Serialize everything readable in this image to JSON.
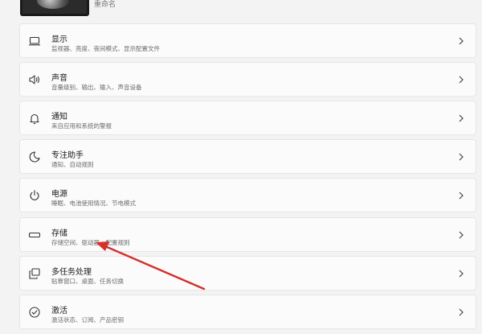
{
  "header": {
    "account_label": "重命名"
  },
  "settings": [
    {
      "icon": "monitor-icon",
      "title": "显示",
      "subtitle": "监视器、亮度、夜间模式、显示配置文件"
    },
    {
      "icon": "speaker-icon",
      "title": "声音",
      "subtitle": "音量级别、输出、输入、声音设备"
    },
    {
      "icon": "bell-icon",
      "title": "通知",
      "subtitle": "来自应用和系统的警报"
    },
    {
      "icon": "moon-icon",
      "title": "专注助手",
      "subtitle": "通知、自动规则"
    },
    {
      "icon": "power-icon",
      "title": "电源",
      "subtitle": "睡眠、电池使用情况、节电模式"
    },
    {
      "icon": "storage-icon",
      "title": "存储",
      "subtitle": "存储空间、驱动器、配置规则"
    },
    {
      "icon": "multitask-icon",
      "title": "多任务处理",
      "subtitle": "贴靠窗口、桌面、任务切换"
    },
    {
      "icon": "activation-icon",
      "title": "激活",
      "subtitle": "激活状态、订阅、产品密钥"
    }
  ],
  "annotation": {
    "color": "#d6302b",
    "icon": "red-pointer-arrow"
  }
}
